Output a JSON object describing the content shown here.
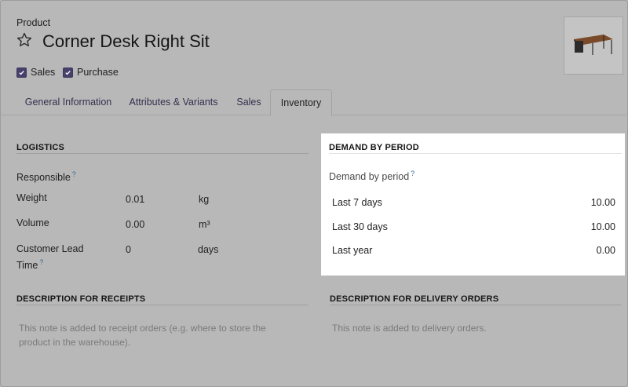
{
  "header": {
    "product_label": "Product",
    "product_name": "Corner Desk Right Sit",
    "checkboxes": [
      {
        "label": "Sales",
        "checked": true
      },
      {
        "label": "Purchase",
        "checked": true
      }
    ]
  },
  "tabs": [
    {
      "label": "General Information",
      "active": false
    },
    {
      "label": "Attributes & Variants",
      "active": false
    },
    {
      "label": "Sales",
      "active": false
    },
    {
      "label": "Inventory",
      "active": true
    }
  ],
  "logistics": {
    "title": "LOGISTICS",
    "responsible_label": "Responsible",
    "help": "?",
    "weight": {
      "label": "Weight",
      "value": "0.01",
      "unit": "kg"
    },
    "volume": {
      "label": "Volume",
      "value": "0.00",
      "unit": "m³"
    },
    "lead_time": {
      "label_line1": "Customer Lead",
      "label_line2": "Time",
      "value": "0",
      "unit": "days"
    }
  },
  "demand": {
    "title": "DEMAND BY PERIOD",
    "subtitle": "Demand by period",
    "help": "?",
    "rows": [
      {
        "label": "Last 7 days",
        "value": "10.00"
      },
      {
        "label": "Last 30 days",
        "value": "10.00"
      },
      {
        "label": "Last year",
        "value": "0.00"
      }
    ]
  },
  "receipts": {
    "title": "DESCRIPTION FOR RECEIPTS",
    "placeholder_line1": "This note is added to receipt orders (e.g. where to store the",
    "placeholder_line2": "product in the warehouse)."
  },
  "delivery": {
    "title": "DESCRIPTION FOR DELIVERY ORDERS",
    "placeholder": "This note is added to delivery orders."
  },
  "colors": {
    "checkbox": "#46406a",
    "help": "#3b6a93",
    "overlay": "#b8b8b8",
    "panel": "#ffffff"
  }
}
